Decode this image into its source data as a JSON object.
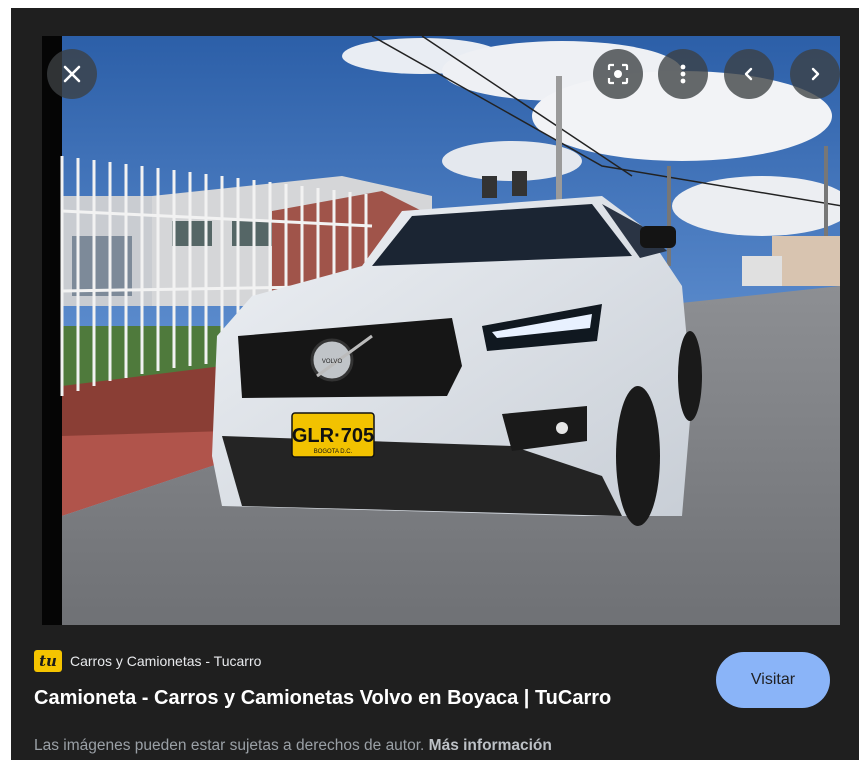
{
  "viewer": {
    "image_alt": "Volvo XC40 blanco estacionado en la calle",
    "plate_text": "GLR·705",
    "plate_city": "BOGOTA D.C.",
    "brand_badge": "VOLVO",
    "controls": {
      "close": "close-icon",
      "lens": "lens-search-icon",
      "more": "more-vert-icon",
      "prev": "chevron-left-icon",
      "next": "chevron-right-icon"
    }
  },
  "result": {
    "favicon_text": "tu",
    "source_name": "Carros y Camionetas - Tucarro",
    "title": "Camioneta - Carros y Camionetas Volvo en Boyaca | TuCarro",
    "visit_label": "Visitar",
    "copyright_notice": "Las imágenes pueden estar sujetas a derechos de autor.",
    "more_info_label": "Más información"
  },
  "colors": {
    "panel_bg": "#1f1f1f",
    "visit_button": "#8ab4f8",
    "plate_yellow": "#f2c200",
    "favicon_yellow": "#f5c400"
  }
}
